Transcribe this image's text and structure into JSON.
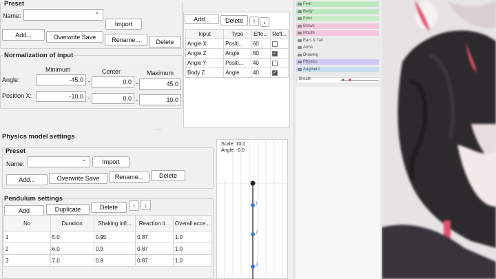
{
  "preset_top": {
    "title": "Preset",
    "name_label": "Name:",
    "name_value": "",
    "import": "Import",
    "add": "Add...",
    "overwrite": "Overwrite Save",
    "rename": "Rename...",
    "delete": "Delete"
  },
  "normalization": {
    "title": "Normalization of input",
    "col_min": "Minimum",
    "col_center": "Center",
    "col_max": "Maximum",
    "rows": [
      {
        "label": "Angle:",
        "min": "-45.0",
        "center": "0.0",
        "max": "45.0"
      },
      {
        "label": "Position X:",
        "min": "-10.0",
        "center": "0.0",
        "max": "10.0"
      }
    ],
    "sep": "-"
  },
  "inputs": {
    "add": "Add...",
    "delete": "Delete",
    "up": "↑",
    "down": "↓",
    "headers": [
      "Input",
      "Type",
      "Effe...",
      "Refl..."
    ],
    "rows": [
      {
        "input": "Angle X",
        "type": "Positi...",
        "effect": "60",
        "reflect": false
      },
      {
        "input": "Angle Z",
        "type": "Angle",
        "effect": "60",
        "reflect": true
      },
      {
        "input": "Angle Y",
        "type": "Positi...",
        "effect": "40",
        "reflect": false
      },
      {
        "input": "Body Z",
        "type": "Angle",
        "effect": "40",
        "reflect": true
      }
    ]
  },
  "layers": {
    "items": [
      {
        "name": "Feet",
        "color": "#bfe9bf"
      },
      {
        "name": "Body",
        "color": "#bfe9bf"
      },
      {
        "name": "Eyes",
        "color": "#c8efc8"
      },
      {
        "name": "Brows",
        "color": "#f3c7dc"
      },
      {
        "name": "Mouth",
        "color": "#f3c7dc"
      },
      {
        "name": "Ears & Tail",
        "color": "#eaeaea"
      },
      {
        "name": "Arms",
        "color": "#eaeaea"
      },
      {
        "name": "Drawing",
        "color": "#eaeaea"
      },
      {
        "name": "Physics",
        "color": "#cfc8f3"
      },
      {
        "name": "Augment",
        "color": "#c8dff3"
      }
    ],
    "breath_label": "Breath"
  },
  "physics": {
    "title": "Physics model settings",
    "preset_title": "Preset",
    "name_label": "Name:",
    "import": "Import",
    "add": "Add...",
    "overwrite": "Overwrite Save",
    "rename": "Rename...",
    "delete": "Delete",
    "pendulum_title": "Pendulum settings",
    "p_add": "Add",
    "p_duplicate": "Duplicate",
    "p_delete": "Delete",
    "p_up": "↑",
    "p_down": "↓",
    "headers": [
      "No",
      "Duration",
      "Shaking infl...",
      "Reaction ti...",
      "Overall acce..."
    ],
    "rows": [
      {
        "no": "1",
        "duration": "5.0",
        "shaking": "0.95",
        "reaction": "0.87",
        "overall": "1.0"
      },
      {
        "no": "2",
        "duration": "6.0",
        "shaking": "0.9",
        "reaction": "0.87",
        "overall": "1.0"
      },
      {
        "no": "3",
        "duration": "7.0",
        "shaking": "0.8",
        "reaction": "0.87",
        "overall": "1.0"
      }
    ]
  },
  "preview": {
    "scale": "Scale: 10.0",
    "angle": "Angle: -0.0",
    "node_labels": [
      "1",
      "2",
      "3"
    ]
  },
  "colors": {
    "accent_node": "#2f7de1",
    "anchor_node": "#222222",
    "breath_marker": "#e0506a"
  },
  "ellipsis": "..."
}
